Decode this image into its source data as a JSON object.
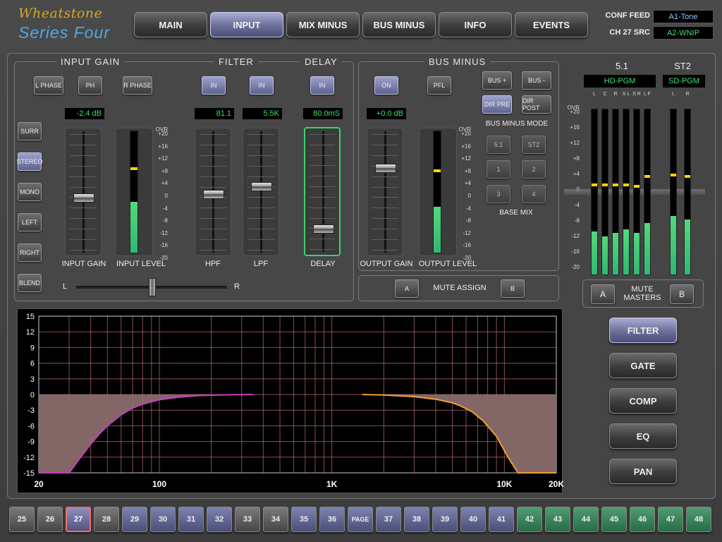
{
  "header": {
    "brand": "Wheatstone",
    "series": "Series Four",
    "tabs": [
      {
        "label": "MAIN"
      },
      {
        "label": "INPUT"
      },
      {
        "label": "MIX MINUS"
      },
      {
        "label": "BUS MINUS"
      },
      {
        "label": "INFO"
      },
      {
        "label": "EVENTS"
      }
    ],
    "conf_feed_label": "CONF FEED",
    "conf_feed_value": "A1-Tone",
    "ch_src_label": "CH 27 SRC",
    "ch_src_value": "A2-WNIP"
  },
  "colors": {
    "active_blue": "#6b6f9a",
    "meter_green": "#2fb873",
    "readout_green": "#37e06a",
    "peak_yellow": "#ffd400",
    "hpf_curve": "#c040c0",
    "lpf_curve": "#f0a030",
    "curve_fill": "#8a6b6b"
  },
  "input_gain": {
    "title": "INPUT GAIN",
    "l_phase": "L PHASE",
    "ph": "PH",
    "r_phase": "R PHASE",
    "gain_readout": "-2.4 dB",
    "modes": [
      "SURR",
      "STEREO",
      "MONO",
      "LEFT",
      "RIGHT",
      "BLEND"
    ],
    "gain_label": "INPUT GAIN",
    "level_label": "INPUT LEVEL",
    "pan_left": "L",
    "pan_right": "R",
    "gain_fader_pos": 0.55,
    "level_meter_fill": 0.42,
    "level_peak": 0.68
  },
  "filter": {
    "title": "FILTER",
    "hpf_in": "IN",
    "lpf_in": "IN",
    "hpf_readout": "81.1",
    "lpf_readout": "5.5K",
    "hpf_label": "HPF",
    "lpf_label": "LPF",
    "hpf_pos": 0.52,
    "lpf_pos": 0.45
  },
  "delay": {
    "title": "DELAY",
    "in": "IN",
    "readout": "80.0mS",
    "label": "DELAY",
    "pos": 0.84
  },
  "meter_scale": [
    "OVR",
    "+20",
    "+16",
    "+12",
    "+8",
    "+4",
    "0",
    "-4",
    "-8",
    "-12",
    "-16",
    "-20"
  ],
  "bus_minus": {
    "title": "BUS MINUS",
    "on": "ON",
    "pfl": "PFL",
    "bus_plus": "BUS +",
    "bus_minus": "BUS -",
    "dir_pre": "DIR PRE",
    "dir_post": "DIR POST",
    "mode_label": "BUS MINUS MODE",
    "mix_buttons": [
      "5.1",
      "ST2",
      "1",
      "2",
      "3",
      "4"
    ],
    "base_mix_label": "BASE MIX",
    "output_readout": "+0.0 dB",
    "output_gain_label": "OUTPUT GAIN",
    "output_level_label": "OUTPUT LEVEL",
    "output_fader_pos": 0.28,
    "output_meter_fill": 0.38,
    "output_peak": 0.66
  },
  "mute_assign": {
    "label": "MUTE ASSIGN",
    "a": "A",
    "b": "B"
  },
  "masters": {
    "surround_title": "5.1",
    "stereo_title": "ST2",
    "surround_src": "HD-PGM",
    "stereo_src": "SD-PGM",
    "surround_channels": [
      "L",
      "C",
      "R",
      "S L",
      "S R",
      "L F"
    ],
    "stereo_channels": [
      "L",
      "R"
    ],
    "surround_fills": [
      0.26,
      0.23,
      0.25,
      0.27,
      0.25,
      0.31
    ],
    "surround_peaks": [
      0.53,
      0.53,
      0.53,
      0.53,
      0.52,
      0.58
    ],
    "stereo_fills": [
      0.35,
      0.33
    ],
    "stereo_peaks": [
      0.59,
      0.58
    ],
    "mute_a": "A",
    "mute_b": "B",
    "mute_label": "MUTE\nMASTERS"
  },
  "side_buttons": [
    {
      "label": "FILTER",
      "active": true
    },
    {
      "label": "GATE",
      "active": false
    },
    {
      "label": "COMP",
      "active": false
    },
    {
      "label": "EQ",
      "active": false
    },
    {
      "label": "PAN",
      "active": false
    }
  ],
  "channels": [
    {
      "label": "25",
      "style": "gray"
    },
    {
      "label": "26",
      "style": "gray"
    },
    {
      "label": "27",
      "style": "sel"
    },
    {
      "label": "28",
      "style": "gray"
    },
    {
      "label": "29",
      "style": "blue"
    },
    {
      "label": "30",
      "style": "blue"
    },
    {
      "label": "31",
      "style": "blue"
    },
    {
      "label": "32",
      "style": "blue"
    },
    {
      "label": "33",
      "style": "gray"
    },
    {
      "label": "34",
      "style": "gray"
    },
    {
      "label": "35",
      "style": "blue"
    },
    {
      "label": "36",
      "style": "blue"
    },
    {
      "label": "PAGE",
      "style": "blue"
    },
    {
      "label": "37",
      "style": "blue"
    },
    {
      "label": "38",
      "style": "blue"
    },
    {
      "label": "39",
      "style": "blue"
    },
    {
      "label": "40",
      "style": "blue"
    },
    {
      "label": "41",
      "style": "blue"
    },
    {
      "label": "42",
      "style": "green"
    },
    {
      "label": "43",
      "style": "green"
    },
    {
      "label": "44",
      "style": "green"
    },
    {
      "label": "45",
      "style": "green"
    },
    {
      "label": "46",
      "style": "green"
    },
    {
      "label": "47",
      "style": "green"
    },
    {
      "label": "48",
      "style": "green"
    }
  ],
  "chart_data": {
    "type": "line",
    "title": "",
    "xlabel": "",
    "ylabel": "",
    "x_scale": "log",
    "xlim": [
      20,
      20000
    ],
    "ylim": [
      -15,
      15
    ],
    "x_ticks": [
      "20",
      "100",
      "1K",
      "10K",
      "20K"
    ],
    "y_ticks": [
      "15",
      "12",
      "9",
      "6",
      "3",
      "0",
      "-3",
      "-6",
      "-9",
      "-12",
      "-15"
    ],
    "grid": true,
    "series": [
      {
        "x": [
          20,
          30,
          35,
          40,
          45,
          50,
          60,
          70,
          81,
          100,
          130,
          170,
          250,
          350
        ],
        "y": [
          -15,
          -15,
          -12,
          -9.5,
          -7.5,
          -6,
          -3.9,
          -2.6,
          -1.8,
          -1.0,
          -0.5,
          -0.2,
          -0.05,
          0
        ]
      },
      {
        "x": [
          1500,
          2000,
          3000,
          4000,
          5000,
          5500,
          6500,
          7500,
          9000,
          10500,
          12000,
          20000
        ],
        "y": [
          0,
          -0.1,
          -0.4,
          -0.9,
          -1.6,
          -2.1,
          -3.3,
          -5.0,
          -8.0,
          -12.0,
          -15,
          -15
        ]
      }
    ]
  }
}
